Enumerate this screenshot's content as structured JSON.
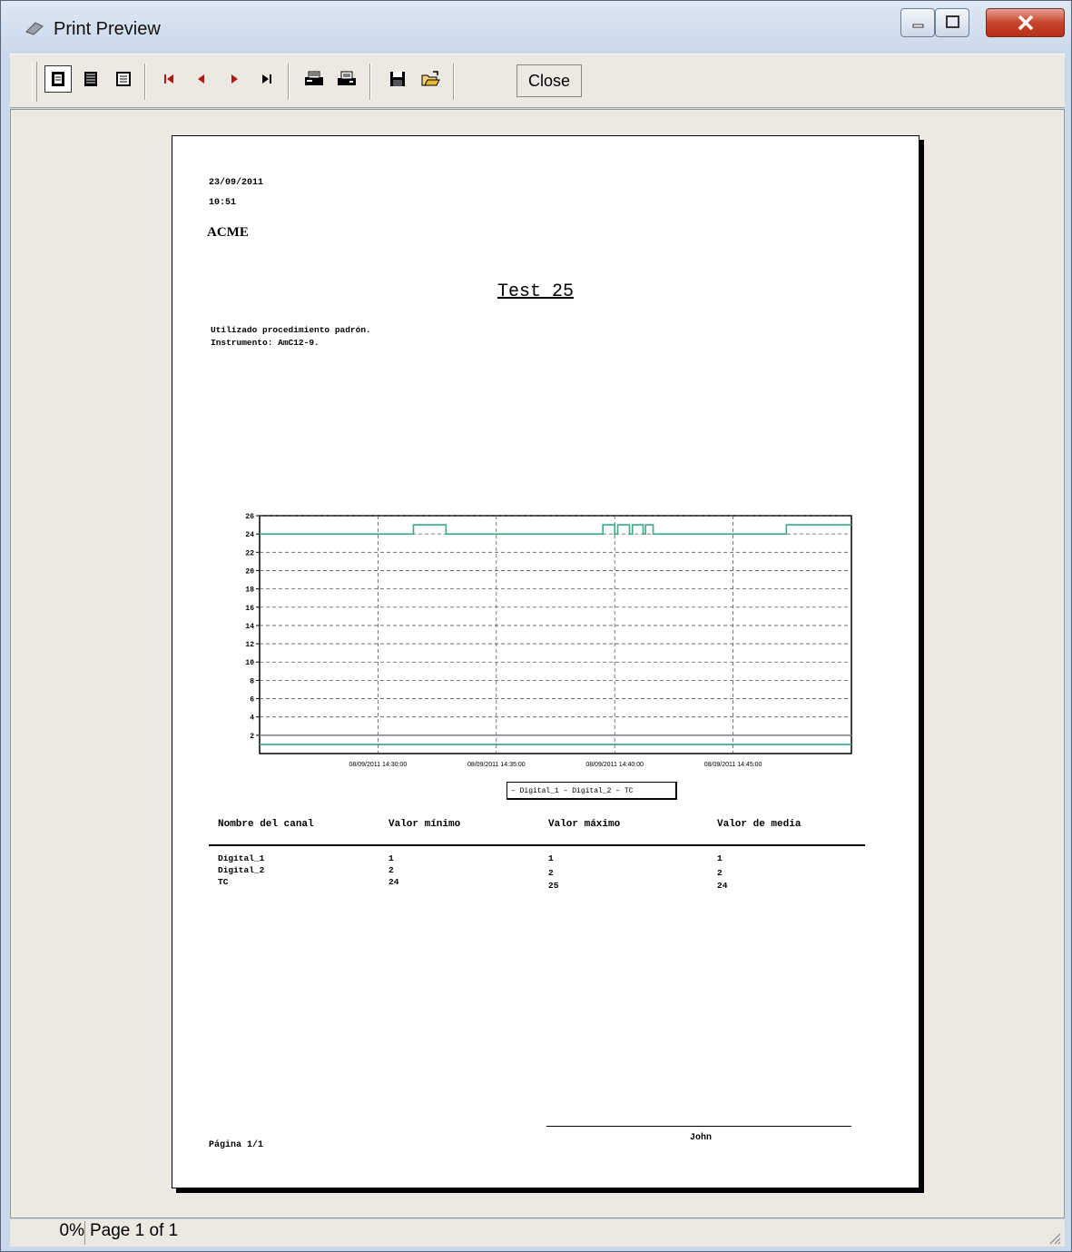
{
  "window": {
    "title": "Print Preview"
  },
  "toolbar": {
    "close_label": "Close"
  },
  "report": {
    "date": "23/09/2011",
    "time": "10:51",
    "company": "ACME",
    "title": "Test 25",
    "lines": [
      "Utilizado procedimiento padrón.",
      "Instrumento: AmC12-9."
    ],
    "legend": "– Digital_1 – Digital_2 – TC",
    "table": {
      "headers": [
        "Nombre del canal",
        "Valor mínimo",
        "Valor máximo",
        "Valor de media"
      ],
      "rows": [
        [
          "Digital_1",
          "1",
          "1",
          "1"
        ],
        [
          "Digital_2",
          "2",
          "2",
          "2"
        ],
        [
          "TC",
          "24",
          "25",
          "24"
        ]
      ]
    },
    "signature": "John",
    "page_label": "Página 1/1"
  },
  "chart_data": {
    "type": "line",
    "ylim": [
      0,
      26
    ],
    "yticks": [
      2,
      4,
      6,
      8,
      10,
      12,
      14,
      16,
      18,
      20,
      22,
      24,
      26
    ],
    "xticks": [
      "08/09/2011 14:30:00",
      "08/09/2011 14:35:00",
      "08/09/2011 14:40:00",
      "08/09/2011 14:45:00"
    ],
    "series": [
      {
        "name": "Digital_1",
        "color": "#3aa08a",
        "x": [
          0,
          1
        ],
        "y": [
          1,
          1
        ]
      },
      {
        "name": "Digital_2",
        "color": "#8a7aa0",
        "x": [
          0,
          1
        ],
        "y": [
          2,
          2
        ]
      },
      {
        "name": "TC",
        "color": "#3aaa88",
        "x": [
          0,
          0.26,
          0.26,
          0.315,
          0.315,
          0.58,
          0.58,
          0.6,
          0.6,
          0.605,
          0.605,
          0.625,
          0.625,
          0.63,
          0.63,
          0.648,
          0.648,
          0.652,
          0.652,
          0.665,
          0.665,
          0.89,
          0.89,
          1
        ],
        "y": [
          24,
          24,
          25,
          25,
          24,
          24,
          25,
          25,
          24,
          24,
          25,
          25,
          24,
          24,
          25,
          25,
          24,
          24,
          25,
          25,
          24,
          24,
          25,
          25
        ]
      }
    ],
    "grid": true
  },
  "status": {
    "zoom": "0%",
    "page": "Page 1 of 1"
  }
}
